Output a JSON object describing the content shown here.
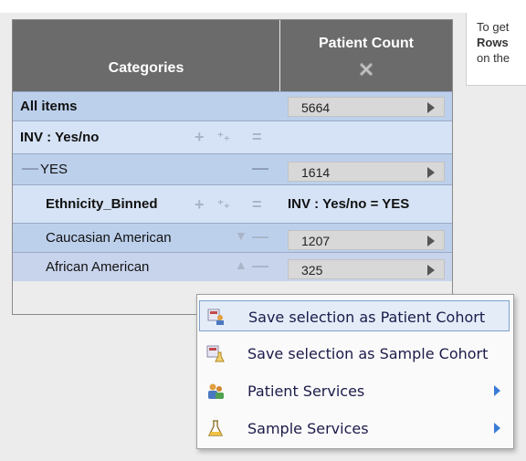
{
  "grid": {
    "header": {
      "categories": "Categories",
      "patient_count": "Patient Count",
      "icon": "x-icon"
    },
    "rows": [
      {
        "label": "All items",
        "value": "5664"
      },
      {
        "label": "INV : Yes/no",
        "controls": "+ ⁺₊ ="
      },
      {
        "label": "YES",
        "collapse": "—",
        "value": "1614"
      },
      {
        "label": "Ethnicity_Binned",
        "controls": "+ ⁺₊ =",
        "subheader": "INV : Yes/no = YES"
      },
      {
        "label": "Caucasian American",
        "value": "1207"
      },
      {
        "label": "African American",
        "value": "325"
      }
    ]
  },
  "tooltip": {
    "line1": "To get",
    "line2": "Rows",
    "line3": "on the"
  },
  "context_menu": {
    "items": [
      {
        "label": "Save selection as Patient Cohort",
        "icon": "patient-cohort-icon",
        "highlighted": true
      },
      {
        "label": "Save selection as Sample Cohort",
        "icon": "sample-cohort-icon"
      },
      {
        "label": "Patient Services",
        "icon": "patient-services-icon",
        "submenu": true
      },
      {
        "label": "Sample Services",
        "icon": "flask-icon",
        "submenu": true
      }
    ]
  },
  "colors": {
    "header": "#6b6b6b",
    "row_selected": "#bcd0ec",
    "row_light": "#d6e3f6",
    "menu_highlight": "#e4ecf8"
  }
}
